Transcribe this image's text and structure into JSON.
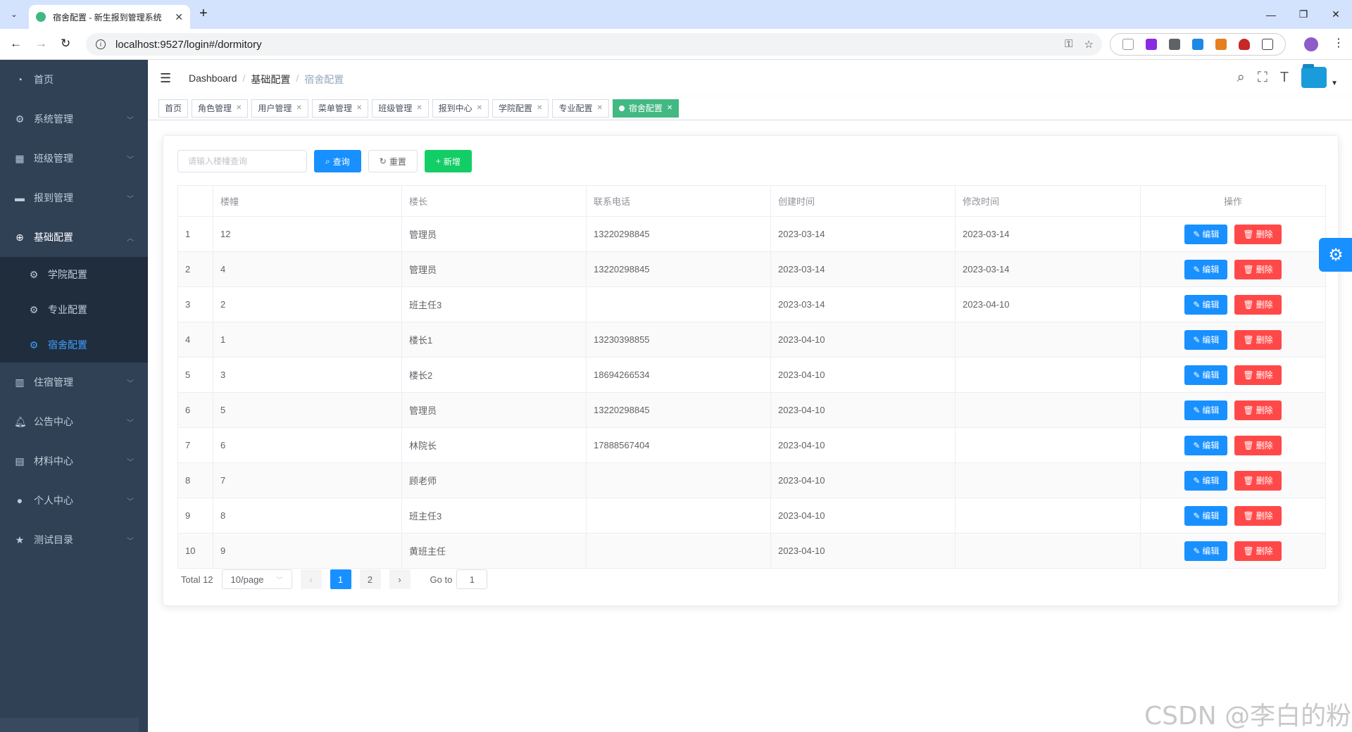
{
  "browser": {
    "tab_title": "宿舍配置 - 新生报到管理系统",
    "url": "localhost:9527/login#/dormitory"
  },
  "sidebar": {
    "items": [
      {
        "label": "首页",
        "icon": "dashboard-icon"
      },
      {
        "label": "系统管理",
        "icon": "gear-icon"
      },
      {
        "label": "班级管理",
        "icon": "grid-icon"
      },
      {
        "label": "报到管理",
        "icon": "monitor-icon"
      },
      {
        "label": "基础配置",
        "icon": "plus-circle-icon"
      },
      {
        "label": "住宿管理",
        "icon": "chart-icon"
      },
      {
        "label": "公告中心",
        "icon": "bell-icon"
      },
      {
        "label": "材料中心",
        "icon": "clipboard-icon"
      },
      {
        "label": "个人中心",
        "icon": "user-icon"
      },
      {
        "label": "测试目录",
        "icon": "star-icon"
      }
    ],
    "sub_items": [
      {
        "label": "学院配置"
      },
      {
        "label": "专业配置"
      },
      {
        "label": "宿舍配置"
      }
    ]
  },
  "navbar": {
    "breadcrumb": [
      "Dashboard",
      "基础配置",
      "宿舍配置"
    ]
  },
  "tags": [
    {
      "label": "首页"
    },
    {
      "label": "角色管理"
    },
    {
      "label": "用户管理"
    },
    {
      "label": "菜单管理"
    },
    {
      "label": "班级管理"
    },
    {
      "label": "报到中心"
    },
    {
      "label": "学院配置"
    },
    {
      "label": "专业配置"
    },
    {
      "label": "宿舍配置"
    }
  ],
  "toolbar": {
    "search_placeholder": "请输入楼幢查询",
    "query_label": "查询",
    "reset_label": "重置",
    "add_label": "新增"
  },
  "table": {
    "headers": [
      "",
      "楼幢",
      "楼长",
      "联系电话",
      "创建时间",
      "修改时间",
      "操作"
    ],
    "rows": [
      [
        "1",
        "12",
        "管理员",
        "13220298845",
        "2023-03-14",
        "2023-03-14"
      ],
      [
        "2",
        "4",
        "管理员",
        "13220298845",
        "2023-03-14",
        "2023-03-14"
      ],
      [
        "3",
        "2",
        "班主任3",
        "",
        "2023-03-14",
        "2023-04-10"
      ],
      [
        "4",
        "1",
        "楼长1",
        "13230398855",
        "2023-04-10",
        ""
      ],
      [
        "5",
        "3",
        "楼长2",
        "18694266534",
        "2023-04-10",
        ""
      ],
      [
        "6",
        "5",
        "管理员",
        "13220298845",
        "2023-04-10",
        ""
      ],
      [
        "7",
        "6",
        "林院长",
        "17888567404",
        "2023-04-10",
        ""
      ],
      [
        "8",
        "7",
        "顾老师",
        "",
        "2023-04-10",
        ""
      ],
      [
        "9",
        "8",
        "班主任3",
        "",
        "2023-04-10",
        ""
      ],
      [
        "10",
        "9",
        "黄班主任",
        "",
        "2023-04-10",
        ""
      ]
    ],
    "edit_label": "编辑",
    "delete_label": "删除"
  },
  "pagination": {
    "total": "Total 12",
    "page_size": "10/page",
    "pages": [
      "1",
      "2"
    ],
    "current_page": "1",
    "goto_label": "Go to",
    "goto_value": "1"
  },
  "watermark": "CSDN @李白的粉"
}
